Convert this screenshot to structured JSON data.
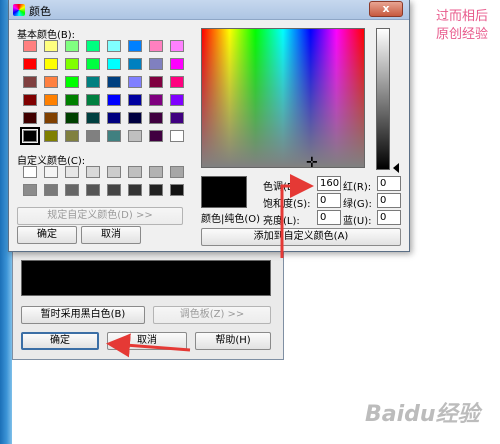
{
  "dialog": {
    "title": "颜色",
    "close_glyph": "x"
  },
  "basic_colors": {
    "label": "基本颜色(B):",
    "swatches": [
      "#ff8080",
      "#ffff80",
      "#80ff80",
      "#00ff80",
      "#80ffff",
      "#0080ff",
      "#ff80c0",
      "#ff80ff",
      "#ff0000",
      "#ffff00",
      "#80ff00",
      "#00ff40",
      "#00ffff",
      "#0080c0",
      "#8080c0",
      "#ff00ff",
      "#804040",
      "#ff8040",
      "#00ff00",
      "#008080",
      "#004080",
      "#8080ff",
      "#800040",
      "#ff0080",
      "#800000",
      "#ff8000",
      "#008000",
      "#008040",
      "#0000ff",
      "#0000a0",
      "#800080",
      "#8000ff",
      "#400000",
      "#804000",
      "#004000",
      "#004040",
      "#000080",
      "#000040",
      "#400040",
      "#400080",
      "#000000",
      "#808000",
      "#808040",
      "#808080",
      "#408080",
      "#c0c0c0",
      "#400040",
      "#ffffff"
    ]
  },
  "custom_colors": {
    "label": "自定义颜色(C):",
    "swatches": [
      "#ffffff",
      "#f4f4f4",
      "#e6e6e6",
      "#d9d9d9",
      "#cccccc",
      "#bfbfbf",
      "#b2b2b2",
      "#a6a6a6",
      "#8c8c8c",
      "#7a7a7a",
      "#666666",
      "#555555",
      "#444444",
      "#333333",
      "#222222",
      "#111111"
    ]
  },
  "buttons": {
    "define_custom": "规定自定义颜色(D) >>",
    "ok": "确定",
    "cancel": "取消",
    "add_custom": "添加到自定义颜色(A)"
  },
  "preview": {
    "label": "颜色|纯色(O)",
    "color": "#000000"
  },
  "fields": {
    "hue": {
      "label": "色调(E):",
      "value": "160"
    },
    "sat": {
      "label": "饱和度(S):",
      "value": "0"
    },
    "lum": {
      "label": "亮度(L):",
      "value": "0"
    },
    "red": {
      "label": "红(R):",
      "value": "0"
    },
    "green": {
      "label": "绿(G):",
      "value": "0"
    },
    "blue": {
      "label": "蓝(U):",
      "value": "0"
    }
  },
  "parent_dialog": {
    "preview_color": "#000000",
    "temp_bw_button": "暂时采用黑白色(B)",
    "palette_button": "调色板(Z) >>",
    "ok": "确定",
    "cancel": "取消",
    "help": "帮助(H)"
  },
  "watermark": {
    "top_line1": "过而相后",
    "top_line2": "原创经验",
    "bottom": "Baidu经验"
  },
  "colors": {
    "arrow": "#e53935",
    "accent": "#3b6ea5"
  }
}
